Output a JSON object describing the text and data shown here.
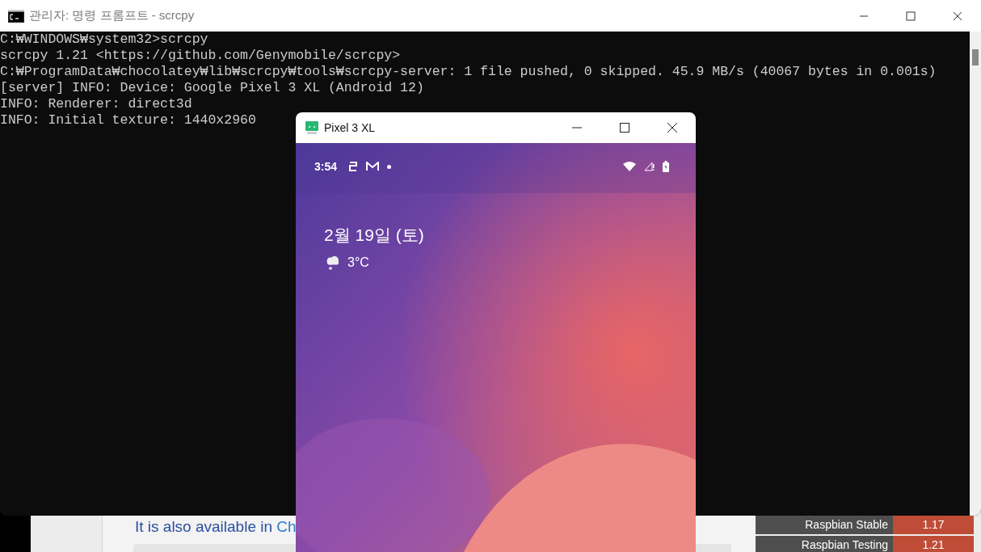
{
  "background_page": {
    "text": "It is also available in ",
    "link": "Ch",
    "versions": [
      {
        "label": "Raspbian Stable",
        "value": "1.17"
      },
      {
        "label": "Raspbian Testing",
        "value": "1.21"
      }
    ]
  },
  "terminal": {
    "title": "관리자: 명령 프롬프트 - scrcpy",
    "lines": [
      "C:₩WINDOWS₩system32>scrcpy",
      "scrcpy 1.21 <https://github.com/Genymobile/scrcpy>",
      "C:₩ProgramData₩chocolatey₩lib₩scrcpy₩tools₩scrcpy-server: 1 file pushed, 0 skipped. 45.9 MB/s (40067 bytes in 0.001s)",
      "[server] INFO: Device: Google Pixel 3 XL (Android 12)",
      "INFO: Renderer: direct3d",
      "INFO: Initial texture: 1440x2960"
    ]
  },
  "phone_window": {
    "title": "Pixel 3 XL",
    "time": "3:54",
    "date": "2월 19일 (토)",
    "temperature": "3°C"
  }
}
